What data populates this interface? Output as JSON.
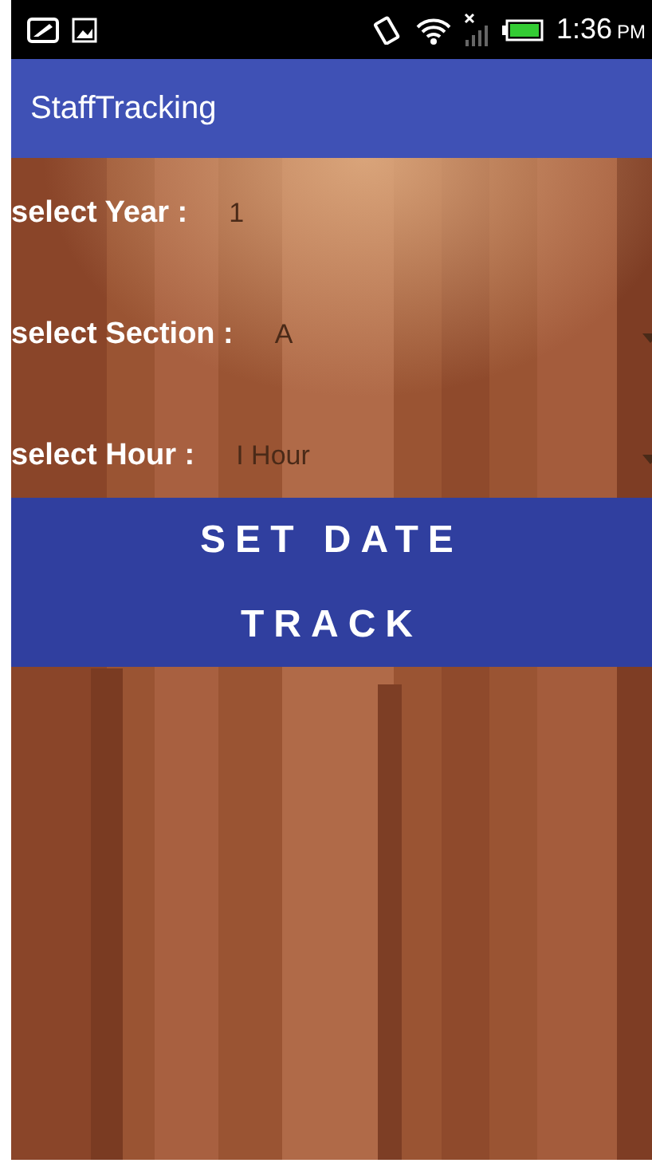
{
  "status_bar": {
    "time": "1:36",
    "am_pm": "PM"
  },
  "app_bar": {
    "title": "StaffTracking"
  },
  "fields": [
    {
      "label": "select Year :",
      "value": "1",
      "arrow": false
    },
    {
      "label": "select Section :",
      "value": "A",
      "arrow": true
    },
    {
      "label": "select Hour :",
      "value": "I Hour",
      "arrow": true
    }
  ],
  "buttons": [
    "SET DATE",
    "TRACK"
  ]
}
